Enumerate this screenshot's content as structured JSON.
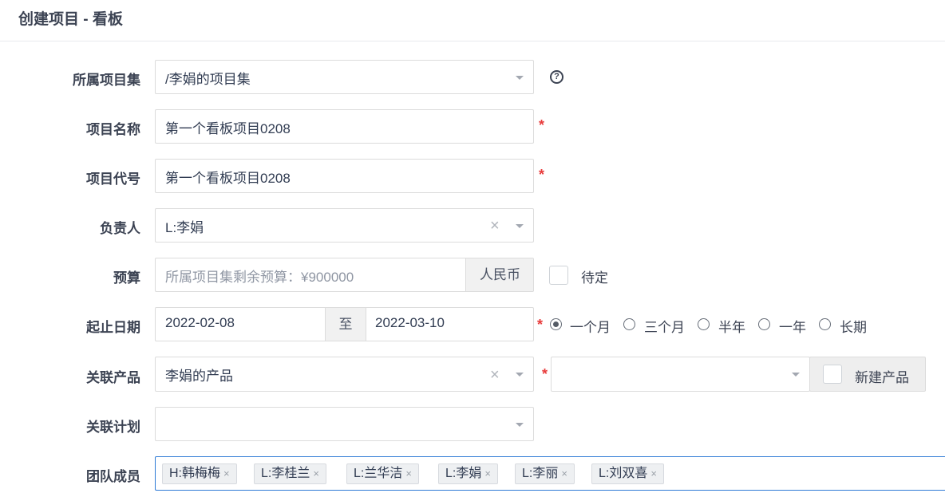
{
  "page": {
    "title": "创建项目 - 看板"
  },
  "form": {
    "program": {
      "label": "所属项目集",
      "value": "/李娟的项目集",
      "help_icon": "question-circle-icon"
    },
    "name": {
      "label": "项目名称",
      "value": "第一个看板项目0208",
      "required_mark": "*"
    },
    "code": {
      "label": "项目代号",
      "value": "第一个看板项目0208",
      "required_mark": "*"
    },
    "owner": {
      "label": "负责人",
      "value": "L:李娟",
      "clear": "×"
    },
    "budget": {
      "label": "预算",
      "placeholder": "所属项目集剩余预算：¥900000",
      "unit": "人民币",
      "tbd_label": "待定",
      "tbd_checked": false
    },
    "dates": {
      "label": "起止日期",
      "begin": "2022-02-08",
      "separator": "至",
      "end": "2022-03-10",
      "required_mark": "*",
      "presets": [
        {
          "label": "一个月",
          "checked": true
        },
        {
          "label": "三个月",
          "checked": false
        },
        {
          "label": "半年",
          "checked": false
        },
        {
          "label": "一年",
          "checked": false
        },
        {
          "label": "长期",
          "checked": false
        }
      ]
    },
    "product": {
      "label": "关联产品",
      "value": "李娟的产品",
      "clear": "×",
      "required_mark": "*",
      "branch_value": "",
      "new_product_label": "新建产品"
    },
    "plan": {
      "label": "关联计划",
      "value": ""
    },
    "team": {
      "label": "团队成员",
      "members": [
        "H:韩梅梅",
        "L:李桂兰",
        "L:兰华洁",
        "L:李娟",
        "L:李丽",
        "L:刘双喜"
      ],
      "remove": "×"
    }
  },
  "colors": {
    "required": "#e83b3b",
    "focus_border": "#2e7ad6",
    "tag_bg": "#eef0f2"
  }
}
